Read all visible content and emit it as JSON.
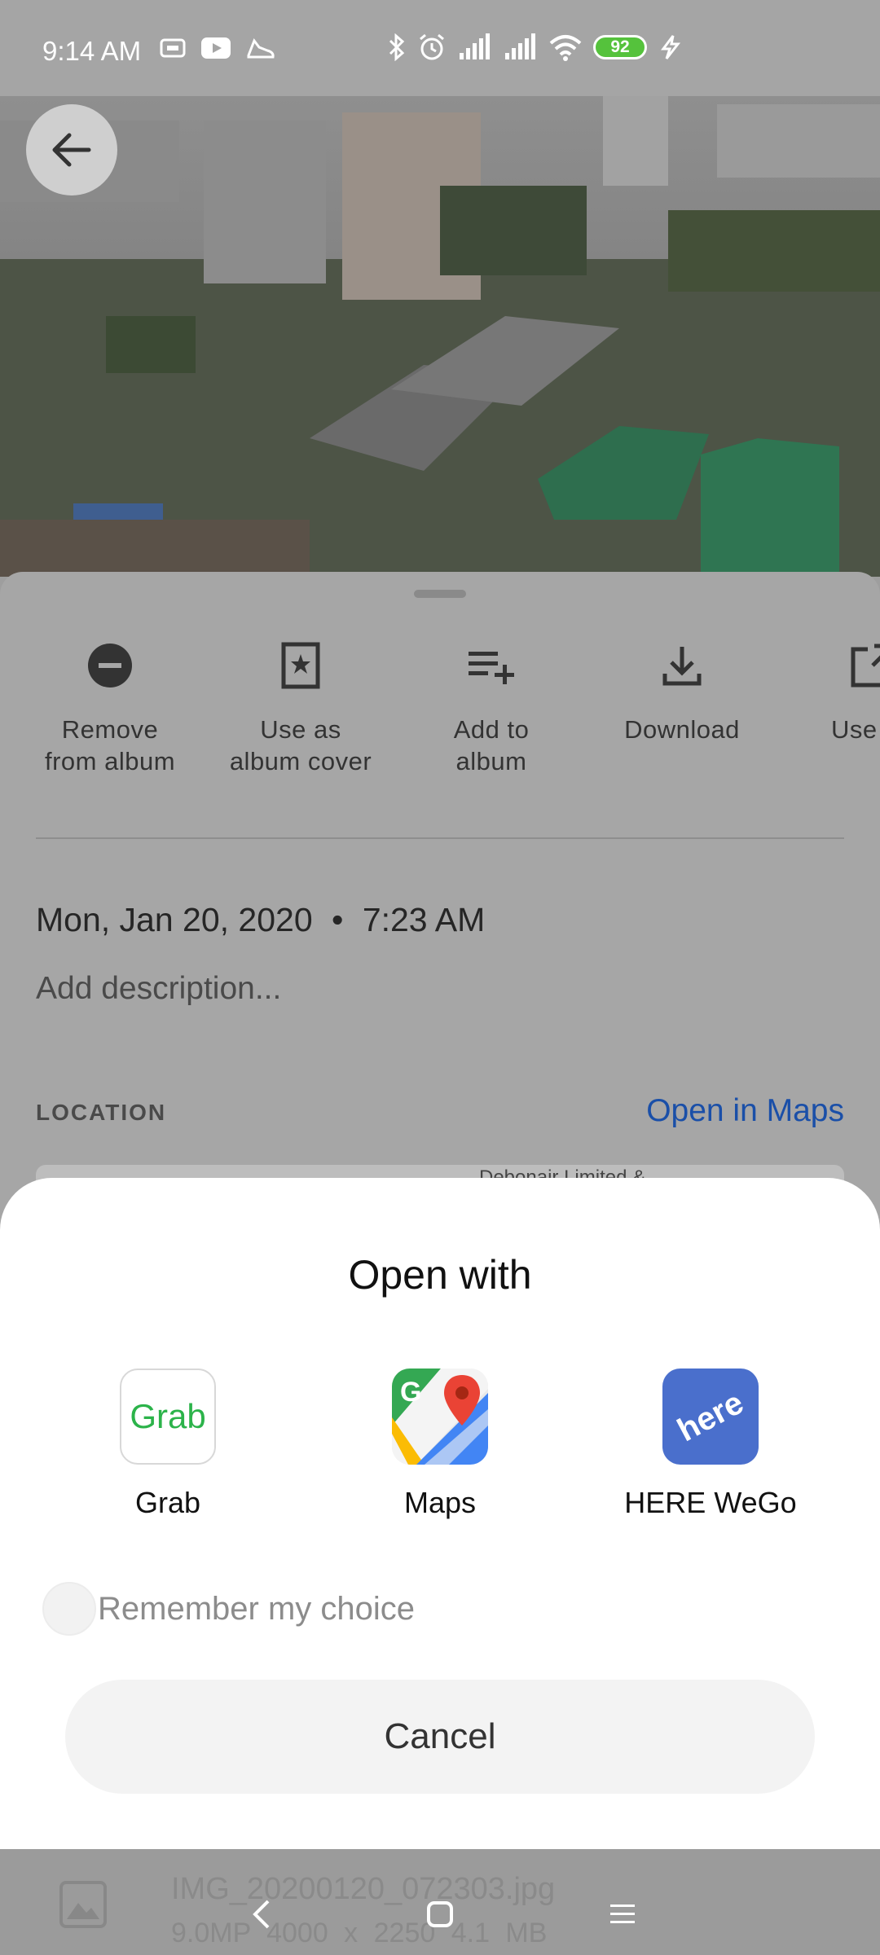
{
  "status_bar": {
    "time": "9:14 AM",
    "battery": "92"
  },
  "details": {
    "actions": [
      {
        "label": "Remove\nfrom album",
        "icon": "remove-circle-icon"
      },
      {
        "label": "Use as\nalbum cover",
        "icon": "album-cover-icon"
      },
      {
        "label": "Add to\nalbum",
        "icon": "playlist-add-icon"
      },
      {
        "label": "Download",
        "icon": "download-icon"
      },
      {
        "label": "Use",
        "icon": "open-external-icon"
      }
    ],
    "date": "Mon, Jan 20, 2020",
    "separator": "•",
    "time": "7:23 AM",
    "description_placeholder": "Add description...",
    "location_label": "LOCATION",
    "open_in_maps": "Open in Maps",
    "map_peek_text": "Debonair Limited &"
  },
  "dialog": {
    "title": "Open with",
    "apps": [
      {
        "name": "Grab",
        "logo_text": "Grab"
      },
      {
        "name": "Maps"
      },
      {
        "name": "HERE WeGo",
        "logo_text": "here"
      }
    ],
    "remember_label": "Remember my choice",
    "cancel_label": "Cancel"
  },
  "file": {
    "name": "IMG_20200120_072303.jpg",
    "meta": "9.0MP   4000 x 2250   4.1 MB"
  },
  "colors": {
    "link_blue": "#1a4fa8",
    "grab_green": "#2cb34a",
    "here_blue": "#4a6fcc",
    "battery_green": "#55c23c"
  }
}
